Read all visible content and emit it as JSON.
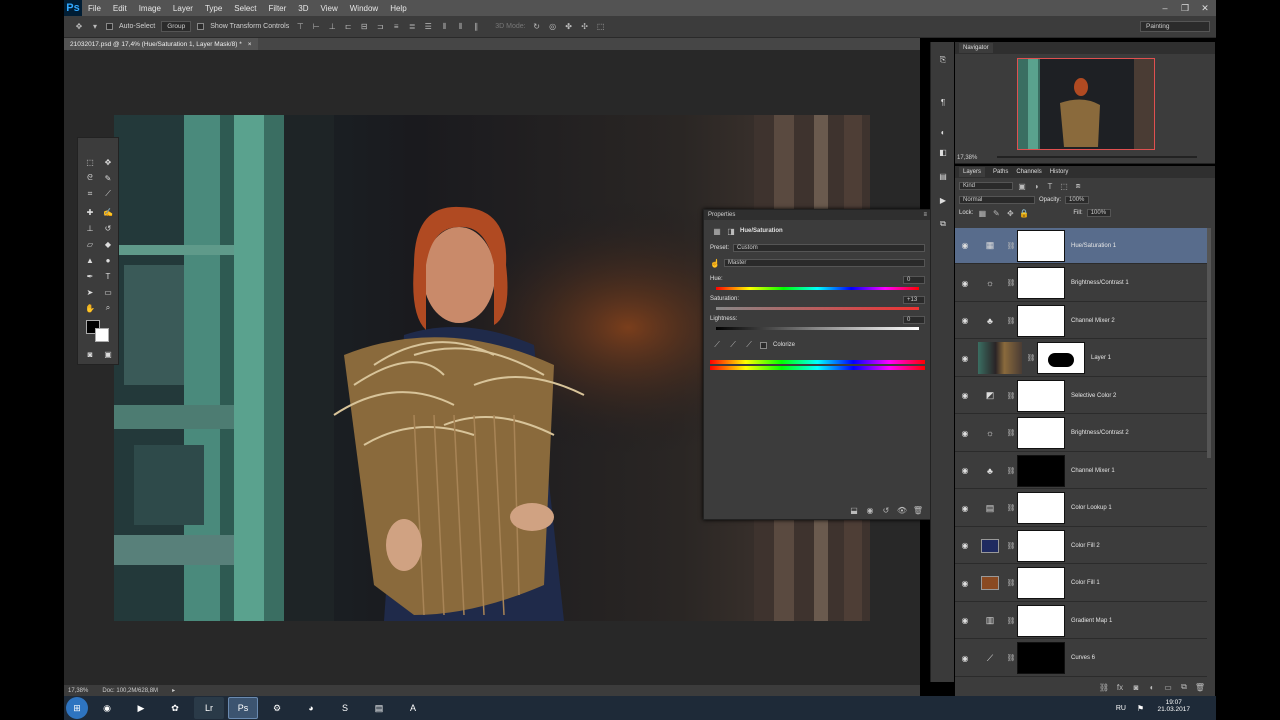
{
  "menu": {
    "logo": "Ps",
    "items": [
      "File",
      "Edit",
      "Image",
      "Layer",
      "Type",
      "Select",
      "Filter",
      "3D",
      "View",
      "Window",
      "Help"
    ]
  },
  "options": {
    "auto_select": "Auto-Select",
    "group": "Group",
    "show_transform": "Show Transform Controls",
    "mode_3d": "3D Mode:",
    "workspace": "Painting"
  },
  "document": {
    "tab_title": "21032017.psd @ 17,4% (Hue/Saturation 1, Layer Mask/8) *",
    "zoom": "17,38%",
    "doc_size": "Doc: 100,2M/628,8M"
  },
  "navigator": {
    "title": "Navigator",
    "zoom": "17,38%"
  },
  "properties": {
    "title": "Properties",
    "adjustment": "Hue/Saturation",
    "preset_label": "Preset:",
    "preset_value": "Custom",
    "channel": "Master",
    "hue_label": "Hue:",
    "hue_value": "0",
    "sat_label": "Saturation:",
    "sat_value": "+13",
    "light_label": "Lightness:",
    "light_value": "0",
    "colorize": "Colorize"
  },
  "layers_panel": {
    "tabs": [
      "Layers",
      "Paths",
      "Channels",
      "History"
    ],
    "kind": "Kind",
    "blend": "Normal",
    "opacity_label": "Opacity:",
    "opacity": "100%",
    "lock_label": "Lock:",
    "fill_label": "Fill:",
    "fill": "100%",
    "layers": [
      {
        "name": "Hue/Saturation 1",
        "icon": "hue-sat-icon",
        "mask": "white",
        "selected": true
      },
      {
        "name": "Brightness/Contrast 1",
        "icon": "brightness-icon",
        "mask": "white",
        "selected": false
      },
      {
        "name": "Channel Mixer 2",
        "icon": "channel-mixer-icon",
        "mask": "white",
        "selected": false
      },
      {
        "name": "Layer 1",
        "icon": "image-thumb",
        "mask": "white",
        "selected": false
      },
      {
        "name": "Selective Color 2",
        "icon": "selective-color-icon",
        "mask": "white",
        "selected": false
      },
      {
        "name": "Brightness/Contrast 2",
        "icon": "brightness-icon",
        "mask": "white",
        "selected": false
      },
      {
        "name": "Channel Mixer 1",
        "icon": "channel-mixer-icon",
        "mask": "black",
        "selected": false
      },
      {
        "name": "Color Lookup 1",
        "icon": "color-lookup-icon",
        "mask": "white",
        "selected": false
      },
      {
        "name": "Color Fill 2",
        "icon": "color-fill-icon",
        "mask": "white",
        "selected": false
      },
      {
        "name": "Color Fill 1",
        "icon": "color-fill-icon",
        "mask": "white",
        "selected": false
      },
      {
        "name": "Gradient Map 1",
        "icon": "gradient-map-icon",
        "mask": "white",
        "selected": false
      },
      {
        "name": "Curves 6",
        "icon": "curves-icon",
        "mask": "black",
        "selected": false
      }
    ]
  },
  "colors": {
    "fill2": "#1f2a60",
    "fill1": "#8a4a22",
    "selected_row": "#586c8c"
  },
  "taskbar": {
    "lang": "RU",
    "time": "19:07",
    "date": "21.03.2017"
  }
}
